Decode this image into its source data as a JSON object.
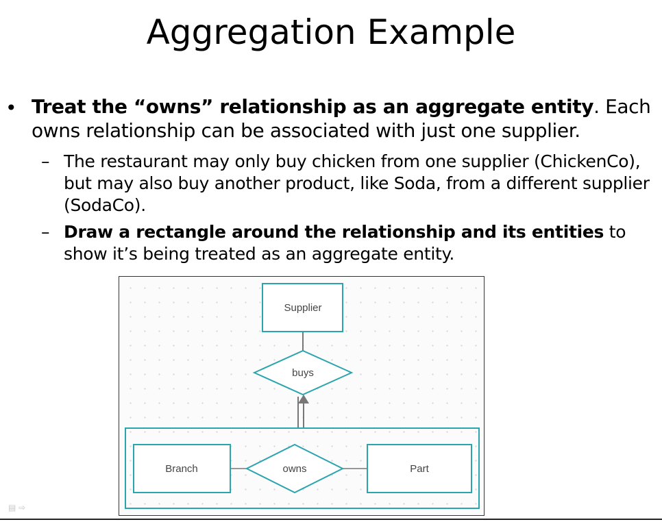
{
  "title": "Aggregation Example",
  "bullet1": {
    "bold": "Treat the “owns” relationship as an aggregate entity",
    "rest": ". Each owns relationship can be associated with just one supplier."
  },
  "sub1": {
    "text": "The restaurant may only buy chicken from one supplier (ChickenCo), but may also buy another product, like Soda, from a different supplier (SodaCo)."
  },
  "sub2": {
    "bold": "Draw a rectangle around the relationship and its entities",
    "rest": " to show it’s being treated as an aggregate entity."
  },
  "diagram": {
    "supplier": "Supplier",
    "buys": "buys",
    "branch": "Branch",
    "owns": "owns",
    "part": "Part",
    "accent": "#2aa4ad"
  }
}
